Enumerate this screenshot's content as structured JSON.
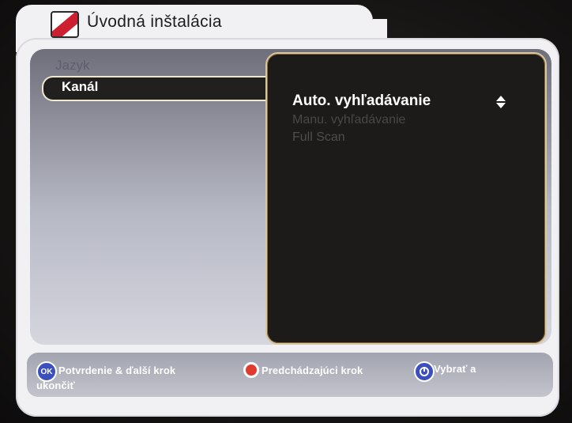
{
  "window": {
    "title": "Úvodná inštalácia"
  },
  "colors": {
    "accent": "#cc1f2f",
    "highlight": "#efe7d0",
    "submenu_bg": "#1c1b1a"
  },
  "menu": {
    "items": [
      {
        "label": "Jazyk"
      },
      {
        "label": "Kanál"
      }
    ]
  },
  "submenu": {
    "options": [
      {
        "label": "Auto. vyhľadávanie"
      },
      {
        "label": "Manu. vyhľadávanie"
      },
      {
        "label": "Full Scan"
      }
    ]
  },
  "footer": {
    "ok_icon": "OK",
    "ok_label": "Potvrdenie & ďalší krok",
    "back_label": "Predchádzajúci krok",
    "exit_label": "Vybrať a",
    "exit_label_2": "ukončiť"
  },
  "icons": {
    "logo": "brand-logo-icon",
    "updown": "up-down-arrows-icon",
    "ok": "ok-button-icon",
    "back": "red-button-icon",
    "exit": "exit-button-icon"
  }
}
